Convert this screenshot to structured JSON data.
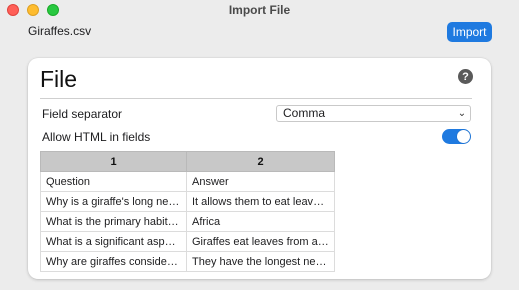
{
  "window": {
    "title": "Import File"
  },
  "toolbar": {
    "filename": "Giraffes.csv",
    "import_label": "Import"
  },
  "card": {
    "title": "File",
    "help_glyph": "?",
    "field_separator": {
      "label": "Field separator",
      "value": "Comma"
    },
    "allow_html": {
      "label": "Allow HTML in fields",
      "enabled": true
    }
  },
  "table": {
    "headers": [
      "1",
      "2"
    ],
    "rows": [
      [
        "Question",
        "Answer"
      ],
      [
        "Why is a giraffe's long neck ...",
        "It allows them to eat leaves ..."
      ],
      [
        "What is the primary habitat ...",
        "Africa"
      ],
      [
        "What is a significant aspect ...",
        "Giraffes eat leaves from aca..."
      ],
      [
        "Why are giraffes considered ...",
        "They have the longest necks..."
      ]
    ]
  },
  "colors": {
    "accent": "#1f7ae0"
  },
  "icons": {
    "help": "question-circle-icon",
    "select": "chevron-updown-icon"
  }
}
